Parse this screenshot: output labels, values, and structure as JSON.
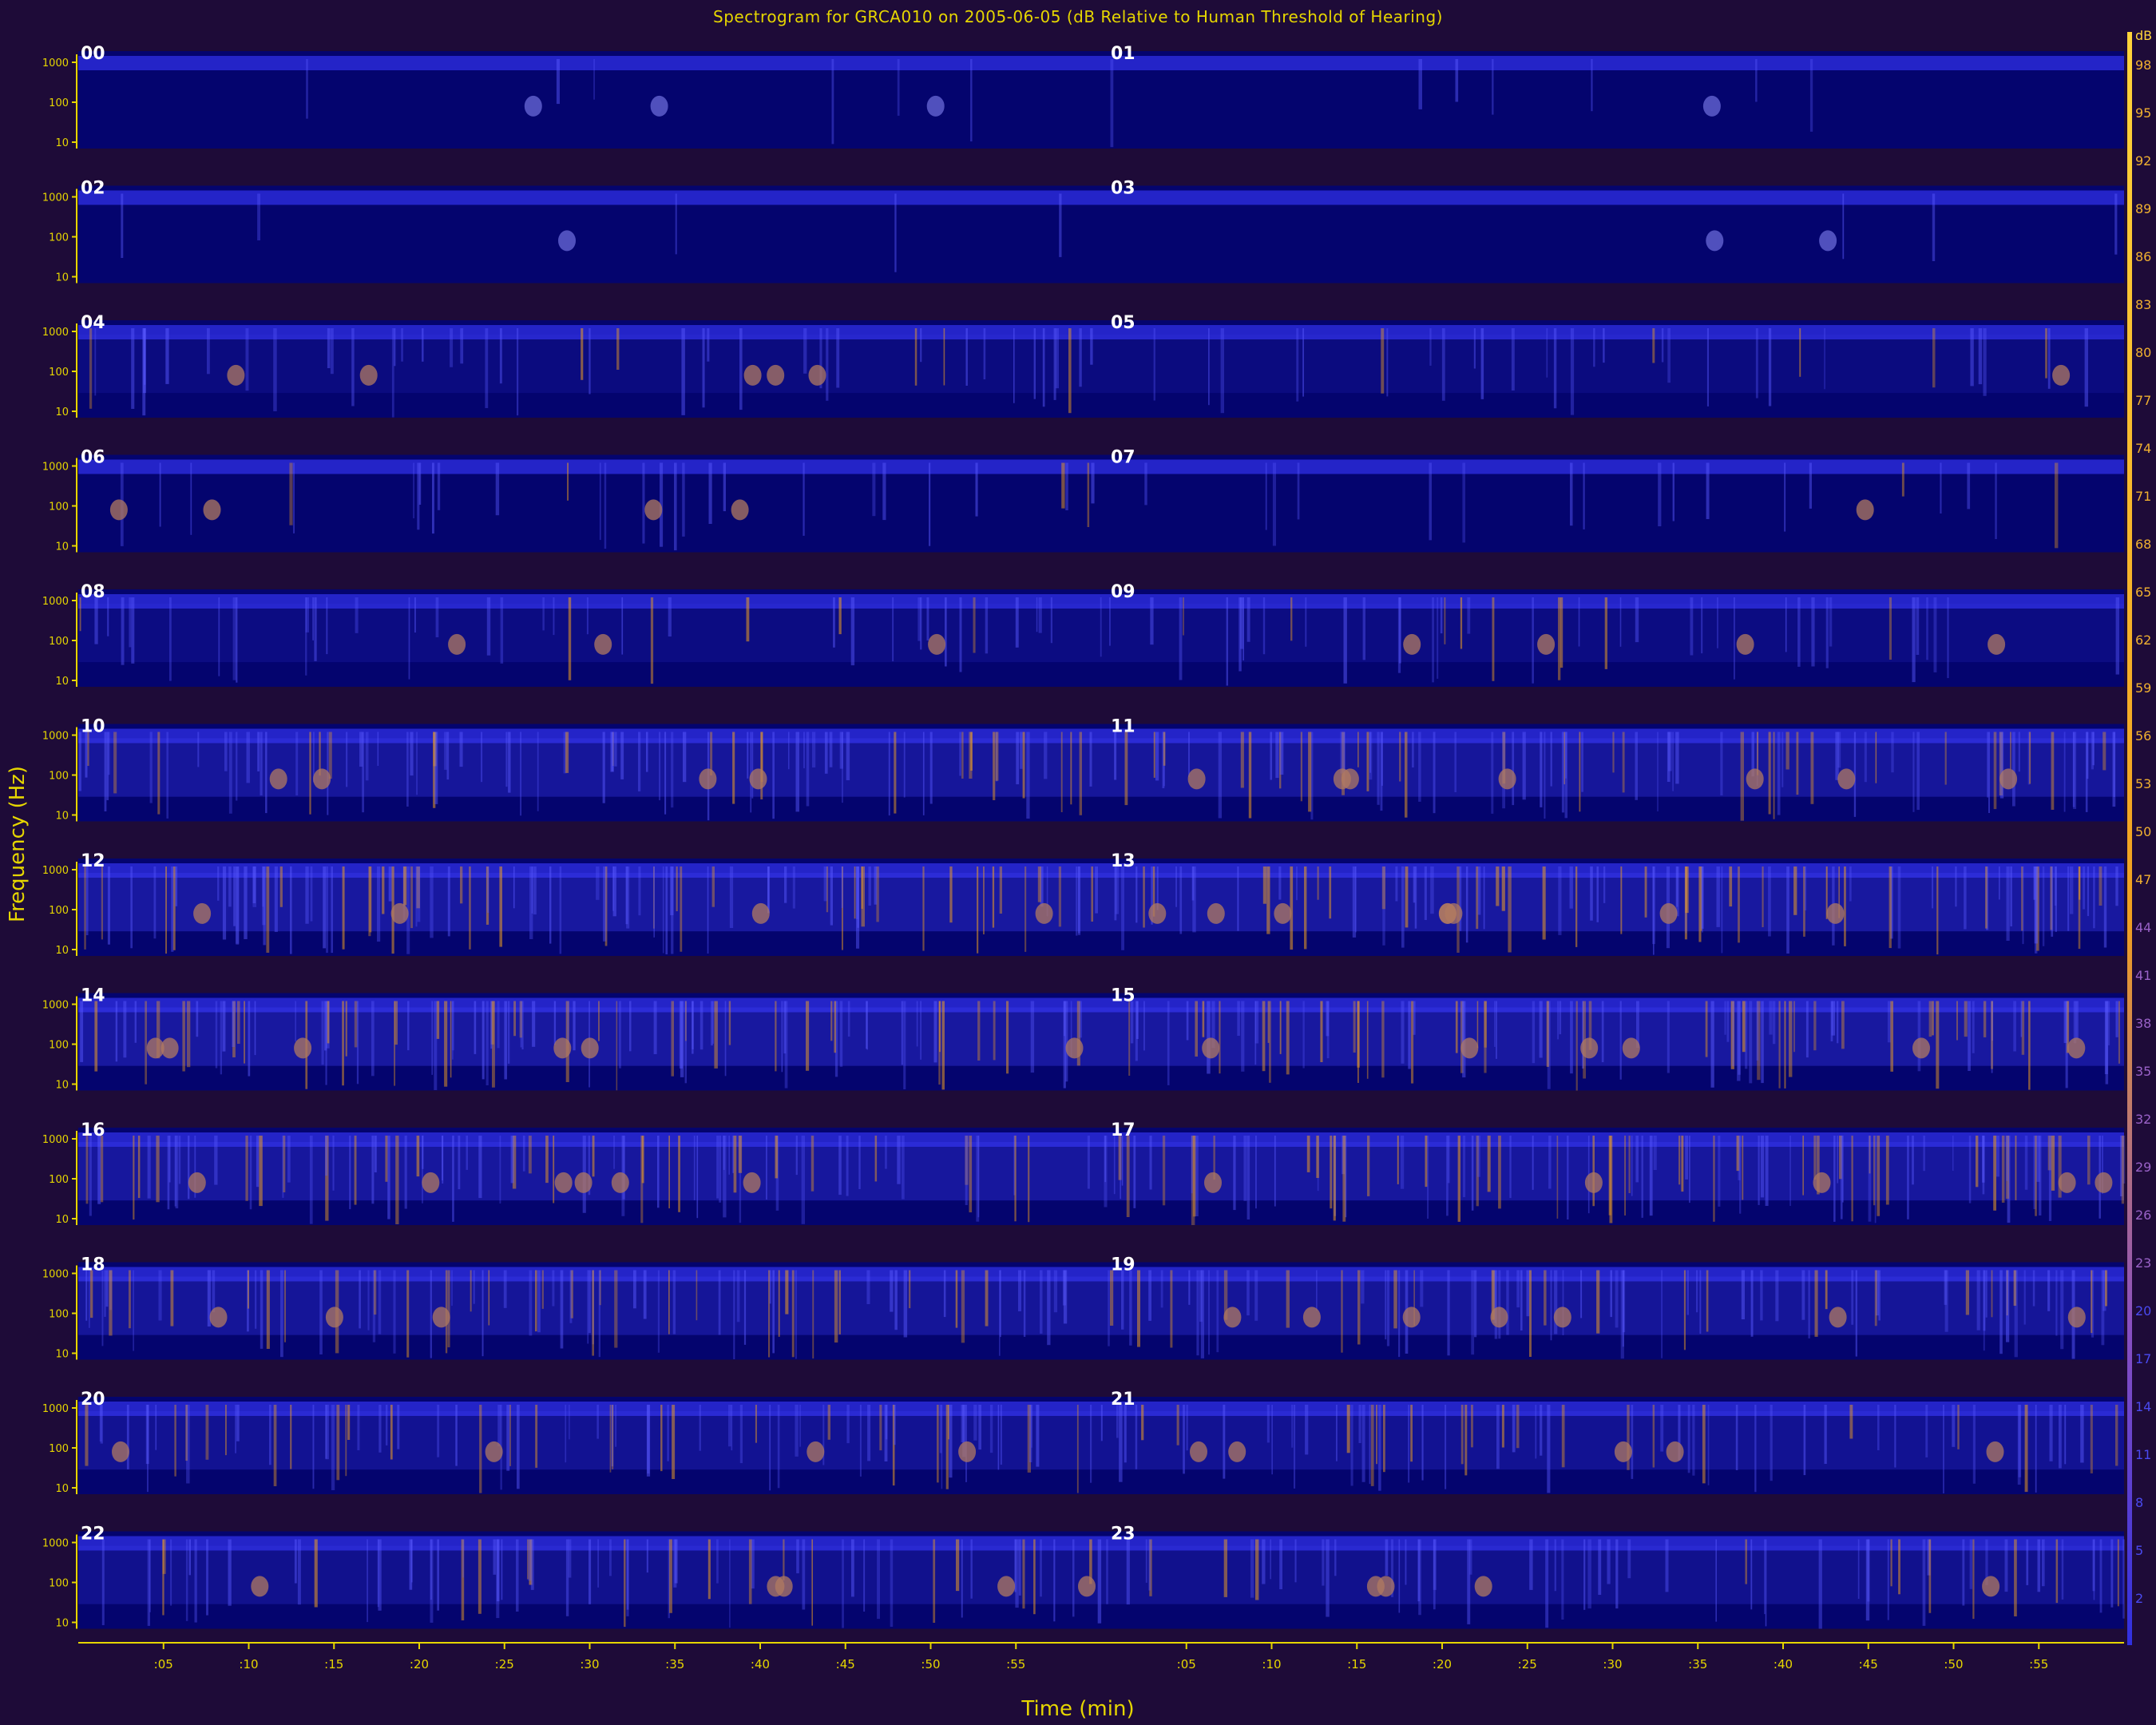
{
  "chart_data": {
    "type": "heatmap",
    "title": "Spectrogram for GRCA010 on 2005-06-05 (dB Relative to Human Threshold of Hearing)",
    "xlabel": "Time (min)",
    "ylabel": "Frequency (Hz)",
    "x_tick_labels": [
      ":05",
      ":10",
      ":15",
      ":20",
      ":25",
      ":30",
      ":35",
      ":40",
      ":45",
      ":50",
      ":55"
    ],
    "y_tick_labels": [
      "1000",
      "100",
      "10"
    ],
    "rows": [
      {
        "left": "00",
        "right": "01"
      },
      {
        "left": "02",
        "right": "03"
      },
      {
        "left": "04",
        "right": "05"
      },
      {
        "left": "06",
        "right": "07"
      },
      {
        "left": "08",
        "right": "09"
      },
      {
        "left": "10",
        "right": "11"
      },
      {
        "left": "12",
        "right": "13"
      },
      {
        "left": "14",
        "right": "15"
      },
      {
        "left": "16",
        "right": "17"
      },
      {
        "left": "18",
        "right": "19"
      },
      {
        "left": "20",
        "right": "21"
      },
      {
        "left": "22",
        "right": "23"
      }
    ],
    "activity": [
      0.05,
      0.03,
      0.3,
      0.18,
      0.35,
      0.75,
      0.85,
      0.85,
      0.82,
      0.72,
      0.62,
      0.55
    ],
    "colorbar": {
      "unit": "dB",
      "ticks": [
        "98",
        "95",
        "92",
        "89",
        "86",
        "83",
        "80",
        "77",
        "74",
        "71",
        "68",
        "65",
        "62",
        "59",
        "56",
        "53",
        "50",
        "47",
        "44",
        "41",
        "38",
        "35",
        "32",
        "29",
        "26",
        "23",
        "20",
        "17",
        "14",
        "11",
        "8",
        "5",
        "2"
      ]
    },
    "colors": {
      "background": "#1e0b38",
      "panel": "#04046e",
      "band": "#2a2ad8",
      "hot": "#f0a020",
      "axis": "#e6d600"
    }
  }
}
